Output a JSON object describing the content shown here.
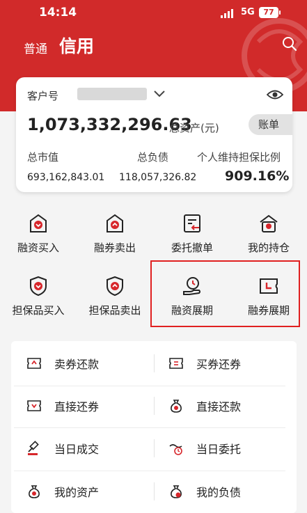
{
  "status_bar": {
    "time": "14:14",
    "network": "5G",
    "battery": "77"
  },
  "header": {
    "tab_normal": "普通",
    "tab_credit": "信用"
  },
  "account": {
    "customer_label": "客户号",
    "total_assets_value": "1,073,332,296.63",
    "total_assets_label": "总资产(元)",
    "bill_label": "账单",
    "market_value_label": "总市值",
    "market_value": "693,162,843.01",
    "total_debt_label": "总负债",
    "total_debt": "118,057,326.82",
    "ratio_label": "个人维持担保比例",
    "ratio_value": "909.16%"
  },
  "grid": [
    {
      "label": "融资买入",
      "icon": "box-down-icon"
    },
    {
      "label": "融券卖出",
      "icon": "box-up-icon"
    },
    {
      "label": "委托撤单",
      "icon": "doc-return-icon"
    },
    {
      "label": "我的持仓",
      "icon": "house-coin-icon"
    },
    {
      "label": "担保品买入",
      "icon": "shield-down-icon"
    },
    {
      "label": "担保品卖出",
      "icon": "shield-up-icon"
    },
    {
      "label": "融资展期",
      "icon": "hand-clock-icon"
    },
    {
      "label": "融券展期",
      "icon": "ticket-clock-icon"
    }
  ],
  "list": [
    {
      "label": "卖券还款",
      "icon": "ticket-up-icon"
    },
    {
      "label": "买券还券",
      "icon": "ticket-exchange-icon"
    },
    {
      "label": "直接还券",
      "icon": "ticket-down-icon"
    },
    {
      "label": "直接还款",
      "icon": "money-bag-icon"
    },
    {
      "label": "当日成交",
      "icon": "gavel-icon"
    },
    {
      "label": "当日委托",
      "icon": "hand-clock-small-icon"
    },
    {
      "label": "我的资产",
      "icon": "asset-bag-icon"
    },
    {
      "label": "我的负债",
      "icon": "debt-bag-icon"
    }
  ],
  "colors": {
    "brand_red": "#d12a2a",
    "icon_red": "#d7262b",
    "highlight_border": "#e02020"
  }
}
